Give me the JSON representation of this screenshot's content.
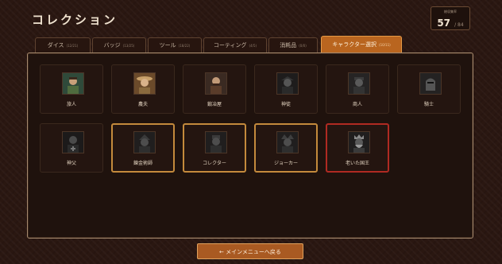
{
  "header": {
    "title": "コレクション"
  },
  "counter": {
    "label": "総収集率",
    "value": "57",
    "total": "/ 84"
  },
  "tabs": [
    {
      "label": "ダイス",
      "count": "(12/21)"
    },
    {
      "label": "バッジ",
      "count": "(13/25)"
    },
    {
      "label": "ツール",
      "count": "(18/22)"
    },
    {
      "label": "コーティング",
      "count": "(4/5)"
    },
    {
      "label": "消耗品",
      "count": "(0/0)"
    },
    {
      "label": "キャラクター選択",
      "count": "(10/11)"
    }
  ],
  "characters": [
    {
      "name": "旅人",
      "state": "normal",
      "icon": "traveler-portrait-icon"
    },
    {
      "name": "農夫",
      "state": "normal",
      "icon": "farmer-portrait-icon"
    },
    {
      "name": "鍛冶屋",
      "state": "normal",
      "icon": "blacksmith-portrait-icon"
    },
    {
      "name": "神徒",
      "state": "normal",
      "icon": "disciple-portrait-icon"
    },
    {
      "name": "商人",
      "state": "normal",
      "icon": "merchant-portrait-icon"
    },
    {
      "name": "騎士",
      "state": "normal",
      "icon": "knight-portrait-icon"
    },
    {
      "name": "神父",
      "state": "normal",
      "icon": "priest-portrait-icon"
    },
    {
      "name": "錬金術師",
      "state": "gold",
      "icon": "alchemist-portrait-icon"
    },
    {
      "name": "コレクター",
      "state": "gold",
      "icon": "collector-portrait-icon"
    },
    {
      "name": "ジョーカー",
      "state": "gold",
      "icon": "joker-portrait-icon"
    },
    {
      "name": "老いた国王",
      "state": "red",
      "icon": "old-king-portrait-icon"
    }
  ],
  "footer": {
    "back_label": "← メインメニューへ戻る"
  },
  "colors": {
    "accent": "#b9651f",
    "gold_border": "#c48a3c",
    "red_border": "#b02a22"
  }
}
